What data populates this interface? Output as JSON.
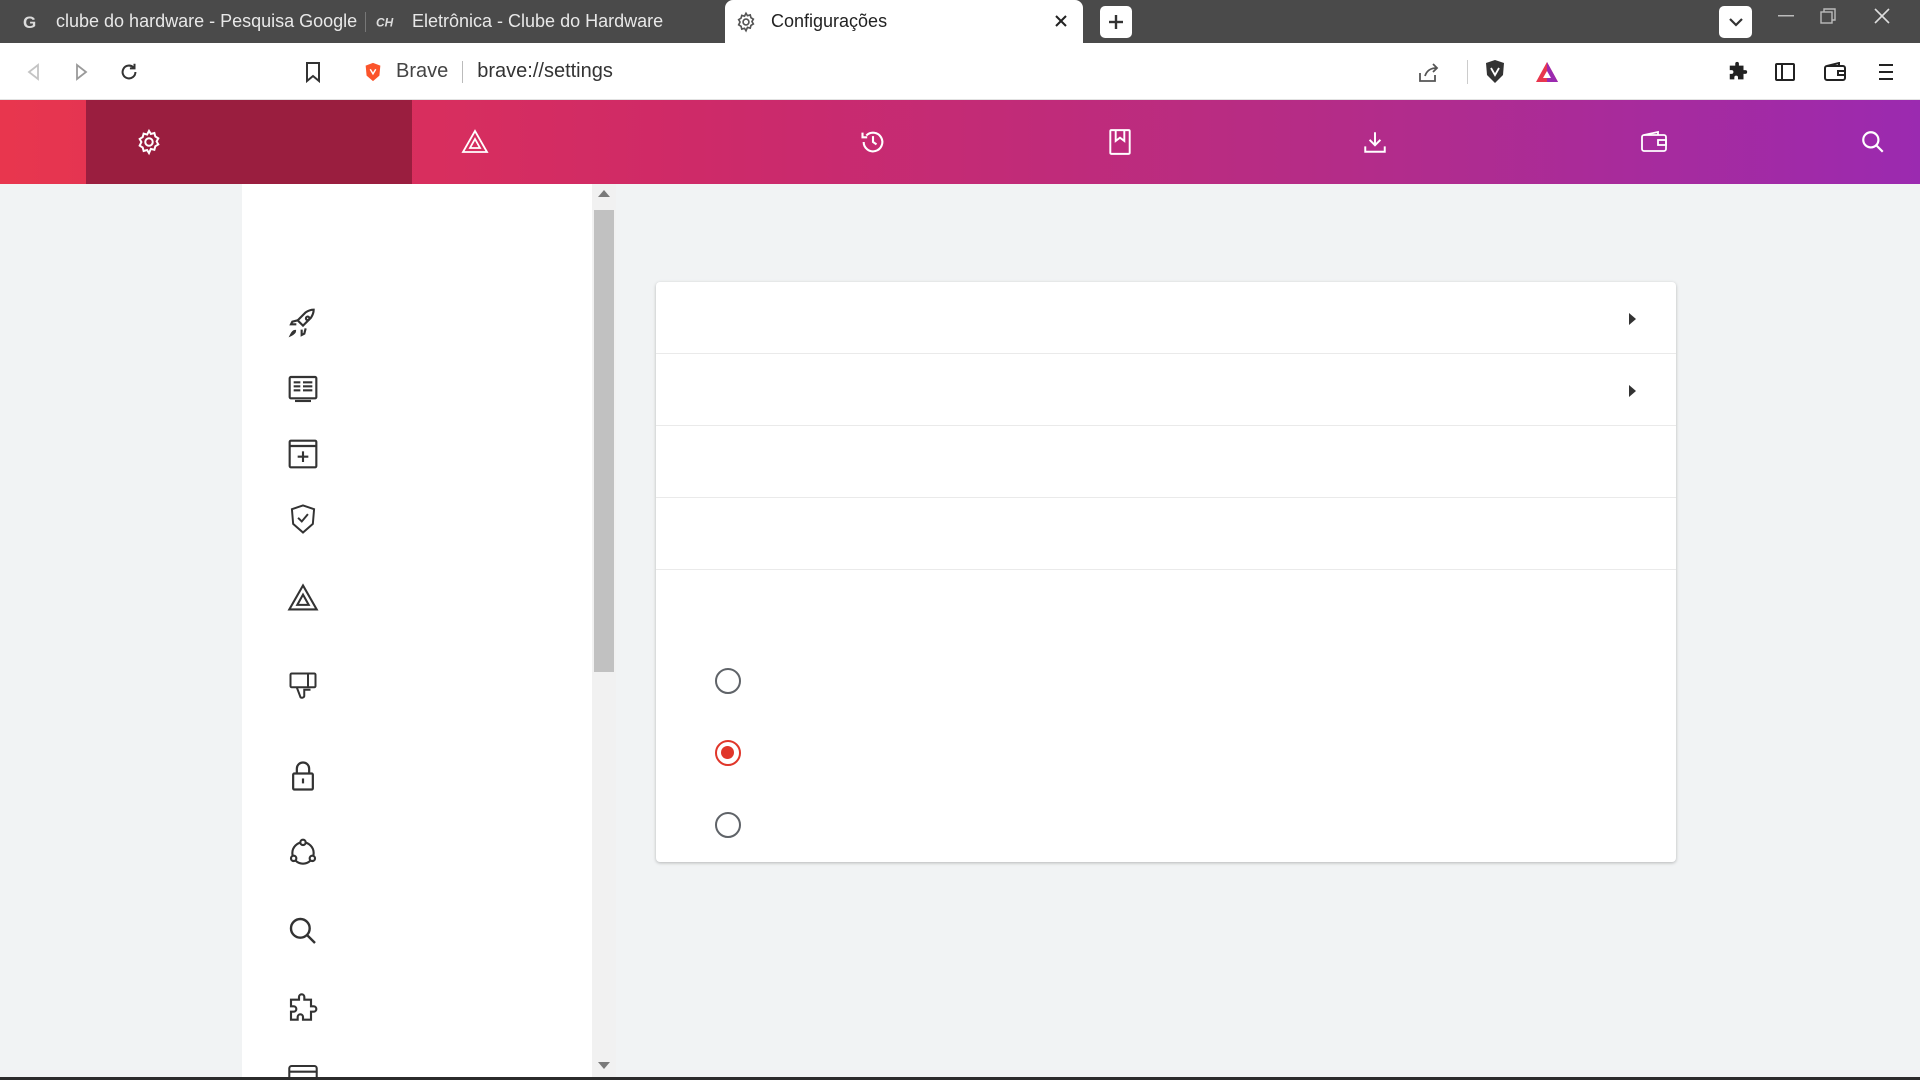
{
  "browser": {
    "tabs": [
      {
        "title": "clube do hardware - Pesquisa Google",
        "icon": "google-icon",
        "active": false
      },
      {
        "title": "Eletrônica - Clube do Hardware",
        "icon": "clube-do-hardware-icon",
        "active": false
      },
      {
        "title": "Configurações",
        "icon": "gear-icon",
        "active": true
      }
    ],
    "omnibox": {
      "brand": "Brave",
      "url": "brave://settings"
    }
  },
  "settings": {
    "top_nav": [
      "gear-icon",
      "brave-rewards-icon",
      "history-icon",
      "bookmarks-icon",
      "downloads-icon",
      "wallet-icon",
      "search-icon"
    ],
    "side_menu_icons": [
      "rocket-icon",
      "appearance-icon",
      "new-tab-icon",
      "shield-icon",
      "brave-rewards-icon",
      "thumbs-down-icon",
      "lock-icon",
      "sync-icon",
      "search-icon",
      "extensions-icon",
      "wallet-icon"
    ],
    "radio_group": {
      "selected_index": 1,
      "count": 3
    }
  },
  "colors": {
    "accent": "#e0362a",
    "nav_gradient_start": "#e8364e",
    "nav_gradient_end": "#9b2ab0",
    "nav_active": "#9a1e3f"
  }
}
